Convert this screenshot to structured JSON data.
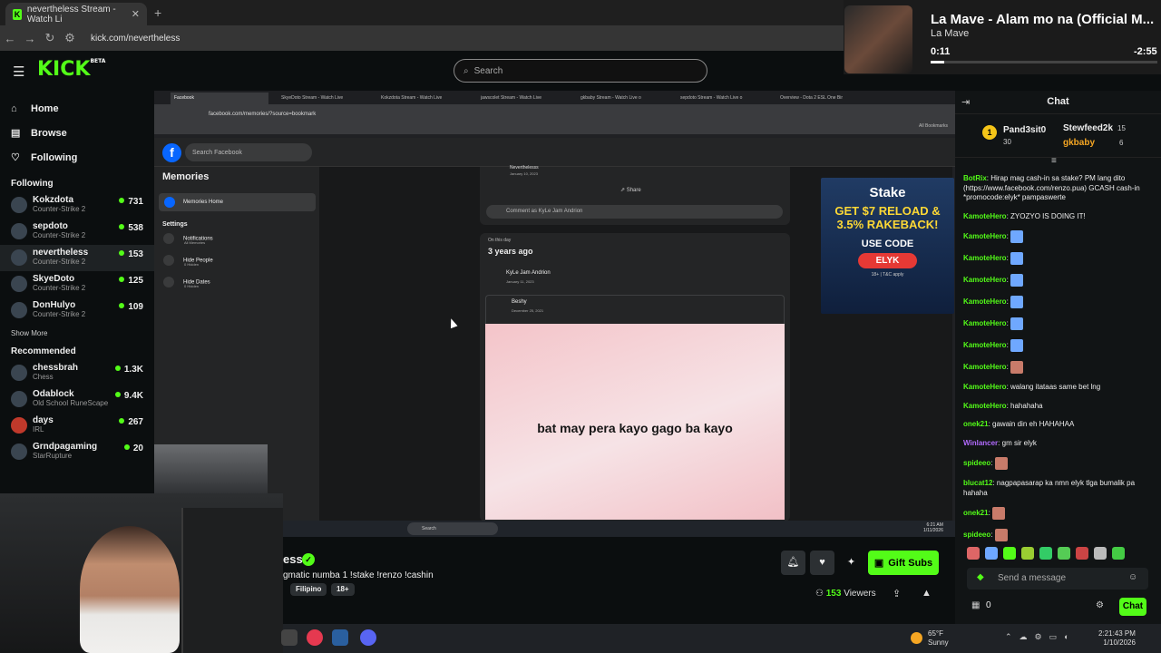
{
  "browser": {
    "tab_title": "nevertheless Stream - Watch Li",
    "url": "kick.com/nevertheless"
  },
  "kick": {
    "logo": "KICK",
    "logo_badge": "BETA",
    "search_placeholder": "Search",
    "nav": [
      {
        "label": "Home",
        "icon": "home-icon"
      },
      {
        "label": "Browse",
        "icon": "browse-icon"
      },
      {
        "label": "Following",
        "icon": "heart-icon"
      }
    ],
    "following_header": "Following",
    "following": [
      {
        "name": "Kokzdota",
        "game": "Counter-Strike 2",
        "viewers": "731"
      },
      {
        "name": "sepdoto",
        "game": "Counter-Strike 2",
        "viewers": "538"
      },
      {
        "name": "nevertheless",
        "game": "Counter-Strike 2",
        "viewers": "153"
      },
      {
        "name": "SkyeDoto",
        "game": "Counter-Strike 2",
        "viewers": "125"
      },
      {
        "name": "DonHulyo",
        "game": "Counter-Strike 2",
        "viewers": "109"
      }
    ],
    "show_more": "Show More",
    "recommended_header": "Recommended",
    "recommended": [
      {
        "name": "chessbrah",
        "game": "Chess",
        "viewers": "1.3K"
      },
      {
        "name": "Odablock",
        "game": "Old School RuneScape",
        "viewers": "9.4K"
      },
      {
        "name": "days",
        "game": "IRL",
        "viewers": "267"
      },
      {
        "name": "Grndpagaming",
        "game": "StarRupture",
        "viewers": "20"
      }
    ]
  },
  "stream_screen": {
    "inner_tabs": [
      "Facebook",
      "SkyeDoto Stream - Watch Live",
      "Kokzdota Stream - Watch Live",
      "jawscolet Stream - Watch Live",
      "gkbaby Stream - Watch Live o",
      "sepdoto Stream - Watch Live o",
      "Overview - Dota 2 ESL One Bir"
    ],
    "inner_url": "facebook.com/memories/?source=bookmark",
    "all_bookmarks": "All Bookmarks",
    "fb_search": "Search Facebook",
    "memories_title": "Memories",
    "memories_home": "Memories Home",
    "settings_label": "Settings",
    "settings_items": [
      {
        "label": "Notifications",
        "sub": "All Memories"
      },
      {
        "label": "Hide People",
        "sub": "0 Hidden"
      },
      {
        "label": "Hide Dates",
        "sub": "0 Hidden"
      }
    ],
    "top_post_author": "Neverthelesss",
    "top_post_date": "January 10, 2023",
    "share_label": "Share",
    "comment_placeholder": "Comment as KyLe Jam Andrion",
    "on_this_day": "On this day",
    "years_ago": "3 years ago",
    "post_author": "KyLe Jam Andrion",
    "post_date": "January 11, 2023",
    "shared_author": "Beshy",
    "shared_date": "December 25, 2021",
    "post_text": "bat may pera kayo gago ba kayo",
    "ad": {
      "brand": "Stake",
      "offer": "GET $7 RELOAD & 3.5% RAKEBACK!",
      "use_code": "USE CODE",
      "code": "ELYK",
      "fine": "18+ | T&C apply"
    },
    "inner_taskbar_search": "Search",
    "inner_time": "6:21 AM",
    "inner_date": "1/11/2026",
    "inner_lang": "ENG INTL"
  },
  "stream_info": {
    "title_fragment": "ess",
    "description": "gmatic numba 1 !stake !renzo !cashin",
    "tags": [
      "Filipino",
      "18+"
    ],
    "viewers_count": "153",
    "viewers_label": "Viewers",
    "gift_subs": "Gift Subs"
  },
  "music": {
    "title": "La Mave - Alam mo na (Official M...",
    "artist": "La Mave",
    "elapsed": "0:11",
    "remaining": "-2:55",
    "progress": 0.06
  },
  "chat": {
    "title": "Chat",
    "leaderboard": [
      {
        "rank": "1",
        "name": "Pand3sit0",
        "count": "30"
      },
      {
        "name": "Stewfeed2k",
        "count": "15"
      },
      {
        "name": "gkbaby",
        "count": "6"
      }
    ],
    "messages": [
      {
        "user": "BotRix",
        "color": "#53fc18",
        "text": "Hirap mag cash-in sa stake? PM lang dito (https://www.facebook.com/renzo.pua) GCASH cash-in *promocode:elyk* pampaswerte"
      },
      {
        "user": "KamoteHero",
        "color": "#53fc18",
        "text": "ZYOZYO IS DOING IT!"
      },
      {
        "user": "KamoteHero",
        "color": "#53fc18",
        "text": "",
        "emote": "#6fa8ff"
      },
      {
        "user": "KamoteHero",
        "color": "#53fc18",
        "text": "",
        "emote": "#6fa8ff"
      },
      {
        "user": "KamoteHero",
        "color": "#53fc18",
        "text": "",
        "emote": "#6fa8ff"
      },
      {
        "user": "KamoteHero",
        "color": "#53fc18",
        "text": "",
        "emote": "#6fa8ff"
      },
      {
        "user": "KamoteHero",
        "color": "#53fc18",
        "text": "",
        "emote": "#6fa8ff"
      },
      {
        "user": "KamoteHero",
        "color": "#53fc18",
        "text": "",
        "emote": "#6fa8ff"
      },
      {
        "user": "KamoteHero",
        "color": "#53fc18",
        "text": "",
        "emote": "#c87b6a"
      },
      {
        "user": "KamoteHero",
        "color": "#53fc18",
        "text": "walang itataas same bet lng"
      },
      {
        "user": "KamoteHero",
        "color": "#53fc18",
        "text": "hahahaha"
      },
      {
        "user": "onek21",
        "color": "#53fc18",
        "text": "gawain din eh HAHAHAA"
      },
      {
        "user": "Winlancer",
        "color": "#b36bff",
        "text": "gm sir elyk"
      },
      {
        "user": "spideeo",
        "color": "#53fc18",
        "text": "",
        "emote": "#c87b6a"
      },
      {
        "user": "blucat12",
        "color": "#53fc18",
        "text": "nagpapasarap ka nmn elyk tlga bumalik pa hahaha"
      },
      {
        "user": "onek21",
        "color": "#53fc18",
        "text": "",
        "emote": "#c87b6a"
      },
      {
        "user": "spideeo",
        "color": "#53fc18",
        "text": "",
        "emote": "#c87b6a"
      }
    ],
    "input_placeholder": "Send a message",
    "points": "0",
    "chat_button": "Chat"
  },
  "os": {
    "weather_temp": "65°F",
    "weather_desc": "Sunny",
    "time": "2:21:43 PM",
    "date": "1/10/2026"
  }
}
